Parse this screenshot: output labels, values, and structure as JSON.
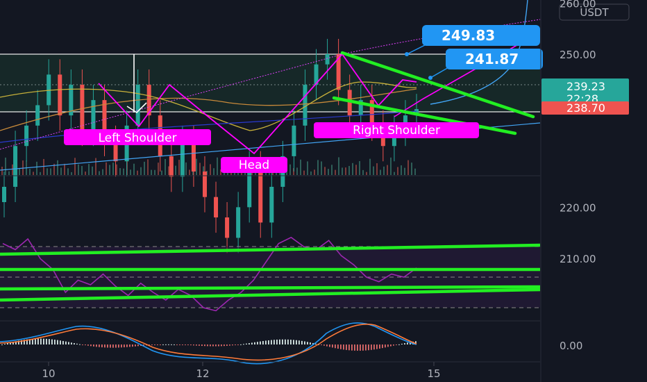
{
  "symbol_quote": "USDT",
  "price_axis": [
    {
      "value": 260,
      "label": "260.00"
    },
    {
      "value": 250,
      "label": "250.00"
    },
    {
      "value": 220,
      "label": "220.00"
    },
    {
      "value": 210,
      "label": "210.00"
    }
  ],
  "macd_axis_label": "0.00",
  "current_price": "239.23",
  "countdown": "22:28",
  "marked_price": "238.70",
  "callouts": [
    {
      "text": "249.83",
      "price": 249.83
    },
    {
      "text": "241.87",
      "price": 241.87
    }
  ],
  "annotations": {
    "left_shoulder": "Left Shoulder",
    "head": "Head",
    "right_shoulder": "Right Shoulder"
  },
  "x_labels": [
    {
      "label": "10",
      "day": 10
    },
    {
      "label": "12",
      "day": 12
    },
    {
      "label": "15",
      "day": 15
    }
  ],
  "colors": {
    "background": "#131722",
    "bull": "#26a69a",
    "bear": "#ef5350",
    "pattern": "#ff00ff",
    "channel": "#22ee22",
    "callout": "#2196f3",
    "rsi": "#9c27b0",
    "current_tag": "#26a69a",
    "marked_tag": "#ef5350"
  },
  "chart_data": [
    {
      "type": "candlestick",
      "title": "",
      "pair_quote": "USDT",
      "ylim": [
        210,
        263
      ],
      "x_days": [
        10,
        12,
        15
      ],
      "close_approx": [
        224,
        232,
        236,
        240,
        246,
        238,
        244,
        235,
        241,
        233,
        229,
        236,
        244,
        238,
        230,
        226,
        233,
        227,
        222,
        218,
        214,
        220,
        228,
        217,
        224,
        230,
        236,
        244,
        248,
        250,
        243,
        238,
        241,
        236,
        232,
        235,
        238,
        239.23
      ],
      "patterns": [
        {
          "name": "Left Shoulder"
        },
        {
          "name": "Head"
        },
        {
          "name": "Right Shoulder"
        }
      ],
      "price_levels": [
        249.83,
        241.87,
        239.23,
        238.7
      ]
    },
    {
      "type": "line",
      "title": "",
      "series": [
        {
          "values": [
            72,
            68,
            75,
            62,
            55,
            40,
            48,
            45,
            52,
            44,
            38,
            46,
            40,
            35,
            42,
            38,
            30,
            28,
            35,
            40,
            48,
            60,
            72,
            76,
            70,
            68,
            74,
            64,
            58,
            50,
            47,
            52,
            50,
            56
          ]
        }
      ]
    },
    {
      "type": "bar",
      "title": "",
      "ylabel_tick": "0.00"
    }
  ]
}
